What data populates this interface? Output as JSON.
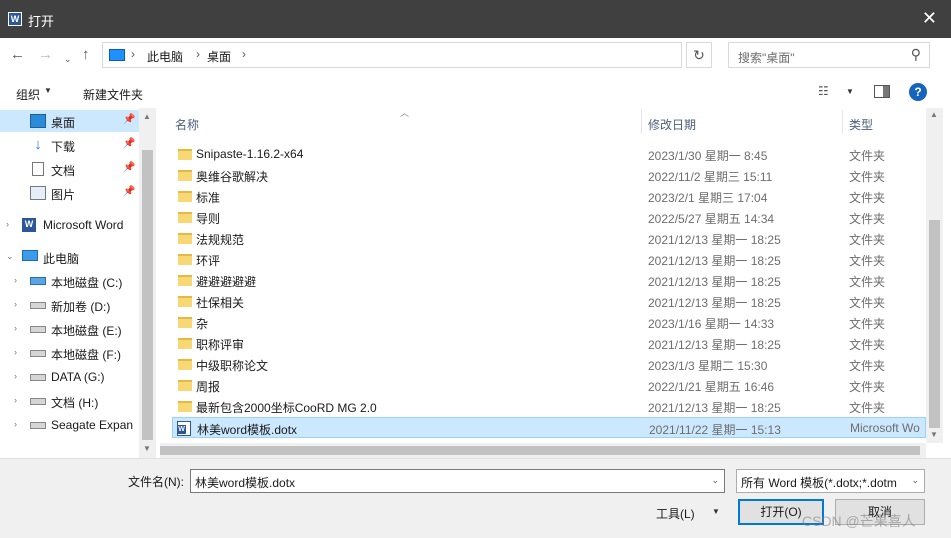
{
  "window": {
    "title": "打开",
    "close": "✕"
  },
  "address": {
    "crumbs": [
      "此电脑",
      "桌面"
    ],
    "search_placeholder": "搜索\"桌面\""
  },
  "toolbar": {
    "organize": "组织",
    "new_folder": "新建文件夹"
  },
  "nav": {
    "items": [
      {
        "label": "桌面",
        "icon": "desktop-icon",
        "pinned": true,
        "selected": true
      },
      {
        "label": "下载",
        "icon": "download-icon",
        "pinned": true
      },
      {
        "label": "文档",
        "icon": "documents-icon",
        "pinned": true
      },
      {
        "label": "图片",
        "icon": "pictures-icon",
        "pinned": true
      },
      {
        "label": "Microsoft Word",
        "icon": "word-icon"
      },
      {
        "label": "此电脑",
        "icon": "this-pc-icon",
        "expanded": true
      },
      {
        "label": "本地磁盘 (C:)",
        "icon": "system-drive-icon"
      },
      {
        "label": "新加卷 (D:)",
        "icon": "drive-icon"
      },
      {
        "label": "本地磁盘 (E:)",
        "icon": "drive-icon"
      },
      {
        "label": "本地磁盘 (F:)",
        "icon": "drive-icon"
      },
      {
        "label": "DATA (G:)",
        "icon": "drive-icon"
      },
      {
        "label": "文档 (H:)",
        "icon": "drive-icon"
      },
      {
        "label": "Seagate Expan",
        "icon": "drive-icon"
      }
    ]
  },
  "columns": {
    "name": "名称",
    "modified": "修改日期",
    "type": "类型"
  },
  "files": [
    {
      "name": "Snipaste-1.16.2-x64",
      "date": "2023/1/30 星期一 8:45",
      "type": "文件夹",
      "kind": "folder"
    },
    {
      "name": "奥维谷歌解决",
      "date": "2022/11/2 星期三 15:11",
      "type": "文件夹",
      "kind": "folder"
    },
    {
      "name": "标准",
      "date": "2023/2/1 星期三 17:04",
      "type": "文件夹",
      "kind": "folder"
    },
    {
      "name": "导则",
      "date": "2022/5/27 星期五 14:34",
      "type": "文件夹",
      "kind": "folder"
    },
    {
      "name": "法规规范",
      "date": "2021/12/13 星期一 18:25",
      "type": "文件夹",
      "kind": "folder"
    },
    {
      "name": "环评",
      "date": "2021/12/13 星期一 18:25",
      "type": "文件夹",
      "kind": "folder"
    },
    {
      "name": "避避避避避",
      "date": "2021/12/13 星期一 18:25",
      "type": "文件夹",
      "kind": "folder"
    },
    {
      "name": "社保相关",
      "date": "2021/12/13 星期一 18:25",
      "type": "文件夹",
      "kind": "folder"
    },
    {
      "name": "杂",
      "date": "2023/1/16 星期一 14:33",
      "type": "文件夹",
      "kind": "folder"
    },
    {
      "name": "职称评审",
      "date": "2021/12/13 星期一 18:25",
      "type": "文件夹",
      "kind": "folder"
    },
    {
      "name": "中级职称论文",
      "date": "2023/1/3 星期二 15:30",
      "type": "文件夹",
      "kind": "folder"
    },
    {
      "name": "周报",
      "date": "2022/1/21 星期五 16:46",
      "type": "文件夹",
      "kind": "folder"
    },
    {
      "name": "最新包含2000坐标CooRD MG 2.0",
      "date": "2021/12/13 星期一 18:25",
      "type": "文件夹",
      "kind": "folder"
    },
    {
      "name": "林美word模板.dotx",
      "date": "2021/11/22 星期一 15:13",
      "type": "Microsoft Wo",
      "kind": "word",
      "selected": true
    }
  ],
  "footer": {
    "filename_label": "文件名(N):",
    "filename_value": "林美word模板.dotx",
    "filetype_value": "所有 Word 模板(*.dotx;*.dotm",
    "tools": "工具(L)",
    "open": "打开(O)",
    "cancel": "取消"
  },
  "watermark": "CSDN @芒果喜人"
}
